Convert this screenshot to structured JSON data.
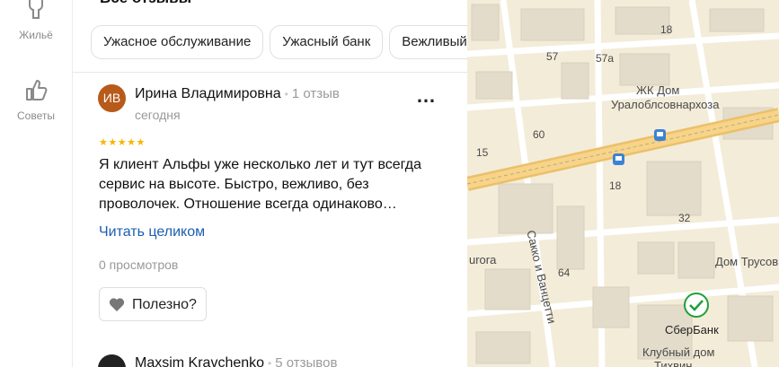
{
  "nav": {
    "housing_label": "Жильё",
    "tips_label": "Советы"
  },
  "panel": {
    "title": "Все отзывы",
    "chips": [
      "Ужасное обслуживание",
      "Ужасный банк",
      "Вежливый"
    ]
  },
  "review1": {
    "avatar_initials": "ИВ",
    "author": "Ирина Владимировна",
    "reviews_count": "1 отзыв",
    "date": "сегодня",
    "rating": 5,
    "text": "Я клиент Альфы уже несколько лет и тут всегда сервис на высоте. Быстро, вежливо, без проволочек. Отношение всегда одинаково…",
    "read_more": "Читать целиком",
    "views": "0 просмотров",
    "useful_label": "Полезно?",
    "more_icon": "more-dots-icon"
  },
  "review2": {
    "author": "Maxsim Kravchenko",
    "reviews_count": "5 отзывов"
  },
  "map": {
    "labels": {
      "jk": "ЖК Дом",
      "jk2": "Уралоблсовнархоза",
      "street": "Сакко и Ванцетти",
      "aurora": "urora",
      "dom_trusov": "Дом Трусов",
      "sber": "СберБанк",
      "club1": "Клубный дом",
      "club2": "Тихвин",
      "n57": "57",
      "n57a": "57а",
      "n18": "18",
      "n60": "60",
      "n15": "15",
      "n18b": "18",
      "n32": "32",
      "n64": "64"
    },
    "colors": {
      "background": "#f3ecd9",
      "major_road": "#f5c86a",
      "building": "#e3dccb"
    }
  }
}
